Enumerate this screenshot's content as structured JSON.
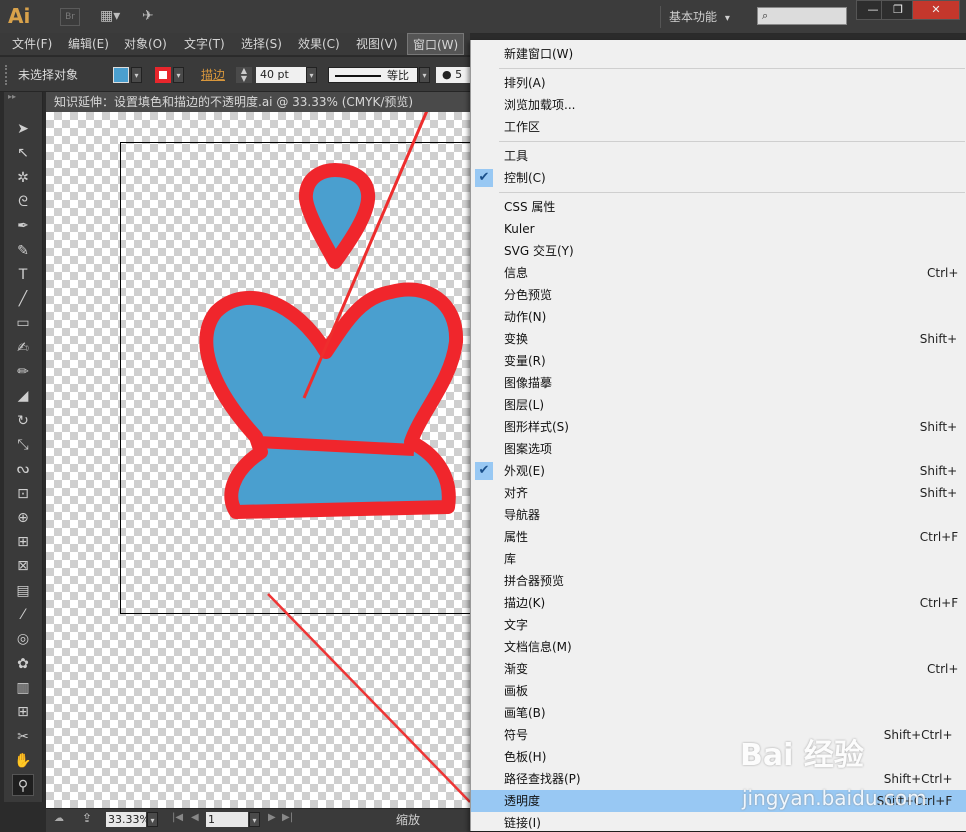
{
  "app": {
    "logo": "Ai",
    "bridge_badge": "Br",
    "workspace": "基本功能",
    "workspace_arrow": "▾",
    "window_controls": [
      "—",
      "❐",
      "✕"
    ]
  },
  "menubar": {
    "items": [
      "文件(F)",
      "编辑(E)",
      "对象(O)",
      "文字(T)",
      "选择(S)",
      "效果(C)",
      "视图(V)",
      "窗口(W)"
    ],
    "active": "窗口(W)"
  },
  "controlbar": {
    "selection_label": "未选择对象",
    "fill_color": "#4a9fcf",
    "stroke_color": "#e8262c",
    "stroke_label": "描边",
    "stroke_weight": "40 pt",
    "stroke_profile": "等比",
    "overflow_text": "5"
  },
  "document": {
    "tab_title": "知识延伸：设置填色和描边的不透明度.ai @ 33.33% (CMYK/预览)",
    "shape_fill": "#4a9fcf",
    "shape_stroke": "#f0262c"
  },
  "statusbar": {
    "zoom": "33.33%",
    "page": "1",
    "status": "缩放"
  },
  "window_menu": {
    "items": [
      {
        "label": "新建窗口(W)",
        "shortcut": "",
        "checked": false
      },
      {
        "sep": true
      },
      {
        "label": "排列(A)",
        "shortcut": "",
        "checked": false
      },
      {
        "label": "浏览加载项...",
        "shortcut": "",
        "checked": false
      },
      {
        "label": "工作区",
        "shortcut": "",
        "checked": false
      },
      {
        "sep": true
      },
      {
        "label": "工具",
        "shortcut": "",
        "checked": false
      },
      {
        "label": "控制(C)",
        "shortcut": "",
        "checked": true
      },
      {
        "sep": true
      },
      {
        "label": "CSS 属性",
        "shortcut": "",
        "checked": false
      },
      {
        "label": "Kuler",
        "shortcut": "",
        "checked": false
      },
      {
        "label": "SVG 交互(Y)",
        "shortcut": "",
        "checked": false
      },
      {
        "label": "信息",
        "shortcut": "Ctrl+",
        "checked": false
      },
      {
        "label": "分色预览",
        "shortcut": "",
        "checked": false
      },
      {
        "label": "动作(N)",
        "shortcut": "",
        "checked": false
      },
      {
        "label": "变换",
        "shortcut": "Shift+",
        "checked": false
      },
      {
        "label": "变量(R)",
        "shortcut": "",
        "checked": false
      },
      {
        "label": "图像描摹",
        "shortcut": "",
        "checked": false
      },
      {
        "label": "图层(L)",
        "shortcut": "",
        "checked": false
      },
      {
        "label": "图形样式(S)",
        "shortcut": "Shift+",
        "checked": false
      },
      {
        "label": "图案选项",
        "shortcut": "",
        "checked": false
      },
      {
        "label": "外观(E)",
        "shortcut": "Shift+",
        "checked": true
      },
      {
        "label": "对齐",
        "shortcut": "Shift+",
        "checked": false
      },
      {
        "label": "导航器",
        "shortcut": "",
        "checked": false
      },
      {
        "label": "属性",
        "shortcut": "Ctrl+F",
        "checked": false
      },
      {
        "label": "库",
        "shortcut": "",
        "checked": false
      },
      {
        "label": "拼合器预览",
        "shortcut": "",
        "checked": false
      },
      {
        "label": "描边(K)",
        "shortcut": "Ctrl+F",
        "checked": false
      },
      {
        "label": "文字",
        "shortcut": "",
        "checked": false
      },
      {
        "label": "文档信息(M)",
        "shortcut": "",
        "checked": false
      },
      {
        "label": "渐变",
        "shortcut": "Ctrl+",
        "checked": false
      },
      {
        "label": "画板",
        "shortcut": "",
        "checked": false
      },
      {
        "label": "画笔(B)",
        "shortcut": "",
        "checked": false
      },
      {
        "label": "符号",
        "shortcut": "Shift+Ctrl+",
        "checked": false
      },
      {
        "label": "色板(H)",
        "shortcut": "",
        "checked": false
      },
      {
        "label": "路径查找器(P)",
        "shortcut": "Shift+Ctrl+",
        "checked": false
      },
      {
        "label": "透明度",
        "shortcut": "Shift+Ctrl+F",
        "checked": false,
        "highlighted": true
      },
      {
        "label": "链接(I)",
        "shortcut": "",
        "checked": false
      }
    ]
  },
  "tools": [
    "selection-tool",
    "direct-selection-tool",
    "magic-wand-tool",
    "lasso-tool",
    "pen-tool",
    "curvature-tool",
    "type-tool",
    "line-tool",
    "rectangle-tool",
    "paintbrush-tool",
    "pencil-tool",
    "eraser-tool",
    "rotate-tool",
    "scale-tool",
    "warp-tool",
    "free-transform-tool",
    "shape-builder-tool",
    "perspective-grid-tool",
    "mesh-tool",
    "gradient-tool",
    "eyedropper-tool",
    "blend-tool",
    "symbol-sprayer-tool",
    "column-graph-tool",
    "artboard-tool",
    "slice-tool",
    "hand-tool",
    "zoom-tool"
  ],
  "tool_glyphs": [
    "➤",
    "↖",
    "✲",
    "ᘓ",
    "✒",
    "✎",
    "T",
    "╱",
    "▭",
    "✍",
    "✏",
    "◢",
    "↻",
    "⤡",
    "ᔓ",
    "⊡",
    "⊕",
    "⊞",
    "⊠",
    "▤",
    "⁄",
    "◎",
    "✿",
    "▥",
    "⊞",
    "✂",
    "✋",
    "⚲"
  ],
  "selected_tool": "zoom-tool",
  "watermark": {
    "text": "Bai 经验",
    "url": "jingyan.baidu.com"
  }
}
